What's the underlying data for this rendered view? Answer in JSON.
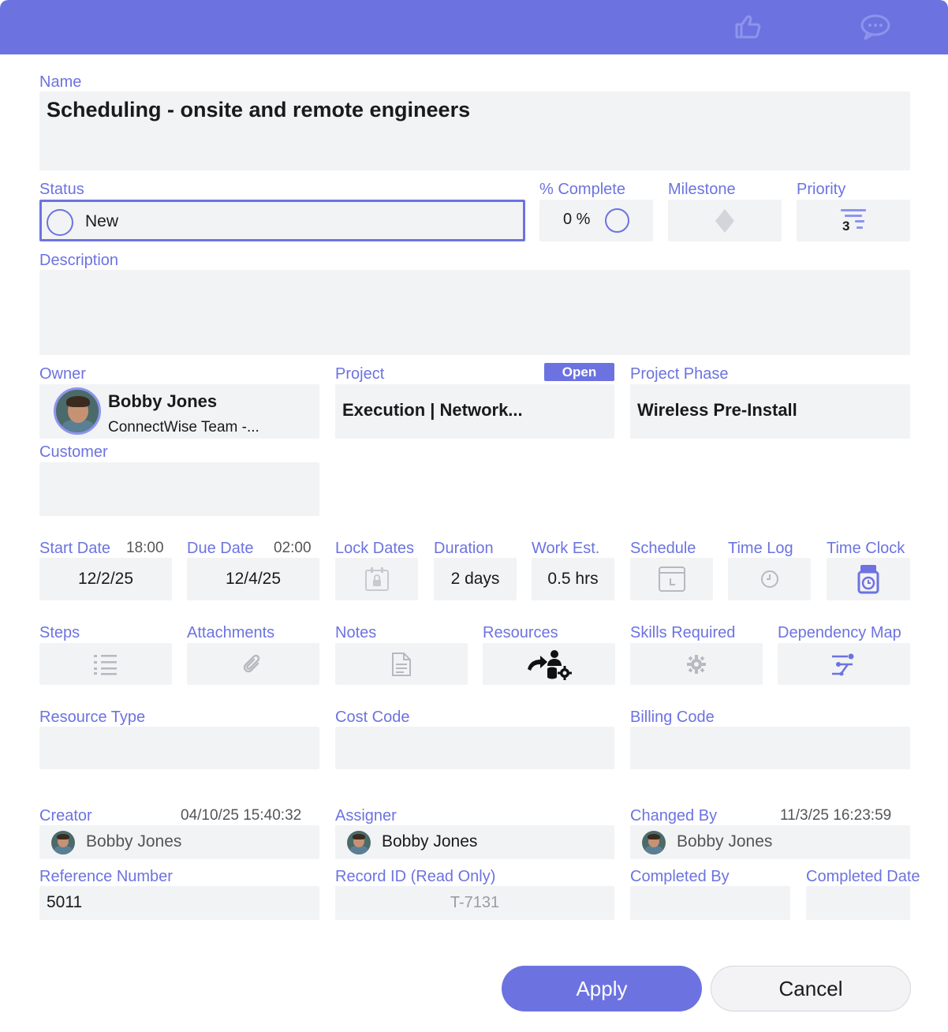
{
  "header": {
    "icons": [
      "thumbs-up-icon",
      "chat-icon"
    ]
  },
  "name": {
    "label": "Name",
    "value": "Scheduling - onsite and remote engineers"
  },
  "status": {
    "label": "Status",
    "value": "New"
  },
  "percent_complete": {
    "label": "% Complete",
    "value": "0 %",
    "fraction": 0
  },
  "milestone": {
    "label": "Milestone"
  },
  "priority": {
    "label": "Priority",
    "value": "3"
  },
  "description": {
    "label": "Description",
    "value": ""
  },
  "owner": {
    "label": "Owner",
    "name": "Bobby Jones",
    "team": "ConnectWise Team -..."
  },
  "project": {
    "label": "Project",
    "badge": "Open",
    "value": "Execution | Network..."
  },
  "project_phase": {
    "label": "Project Phase",
    "value": "Wireless Pre-Install"
  },
  "customer": {
    "label": "Customer",
    "value": ""
  },
  "start_date": {
    "label": "Start Date",
    "time": "18:00",
    "value": "12/2/25"
  },
  "due_date": {
    "label": "Due Date",
    "time": "02:00",
    "value": "12/4/25"
  },
  "lock_dates": {
    "label": "Lock Dates"
  },
  "duration": {
    "label": "Duration",
    "value": "2 days"
  },
  "work_est": {
    "label": "Work Est.",
    "value": "0.5 hrs"
  },
  "schedule": {
    "label": "Schedule"
  },
  "time_log": {
    "label": "Time Log"
  },
  "time_clock": {
    "label": "Time Clock"
  },
  "steps": {
    "label": "Steps"
  },
  "attachments": {
    "label": "Attachments"
  },
  "notes": {
    "label": "Notes"
  },
  "resources": {
    "label": "Resources"
  },
  "skills_required": {
    "label": "Skills Required"
  },
  "dependency_map": {
    "label": "Dependency Map"
  },
  "resource_type": {
    "label": "Resource Type",
    "value": ""
  },
  "cost_code": {
    "label": "Cost Code",
    "value": ""
  },
  "billing_code": {
    "label": "Billing Code",
    "value": ""
  },
  "creator": {
    "label": "Creator",
    "timestamp": "04/10/25  15:40:32",
    "name": "Bobby Jones"
  },
  "assigner": {
    "label": "Assigner",
    "name": "Bobby Jones"
  },
  "changed_by": {
    "label": "Changed By",
    "timestamp": "11/3/25  16:23:59",
    "name": "Bobby Jones"
  },
  "reference_number": {
    "label": "Reference Number",
    "value": "5011"
  },
  "record_id": {
    "label": "Record ID (Read Only)",
    "value": "T-7131"
  },
  "completed_by": {
    "label": "Completed By",
    "value": ""
  },
  "completed_date": {
    "label": "Completed Date",
    "value": ""
  },
  "actions": {
    "apply": "Apply",
    "cancel": "Cancel"
  },
  "colors": {
    "accent": "#6c73e0",
    "field_bg": "#f2f3f5",
    "muted_icon": "#b7b9c0"
  }
}
